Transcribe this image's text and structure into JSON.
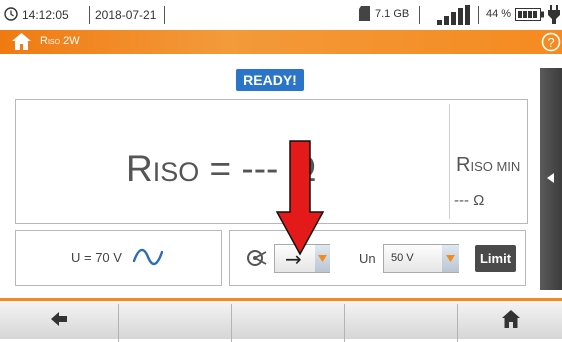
{
  "status_bar": {
    "time": "14:12:05",
    "date": "2018-07-21",
    "storage": "7.1 GB",
    "battery_percent": "44 %",
    "signal_bars": 4
  },
  "header": {
    "title_main": "R",
    "title_sub": "ISO",
    "title_suffix": " 2W"
  },
  "status_badge": "READY!",
  "main_reading": {
    "symbol": "R",
    "subscript": "ISO",
    "equals_value": " = --- Ω"
  },
  "min_reading": {
    "symbol": "R",
    "subscript": "ISO MIN",
    "value": "--- Ω"
  },
  "voltage_panel": {
    "label": "U = 70 V"
  },
  "controls": {
    "mode_value": "→",
    "un_label": "Un",
    "un_value": "50 V",
    "limit_label": "Limit"
  },
  "colors": {
    "accent_orange": "#f28a1f",
    "ready_blue": "#2a74c9",
    "annotation_red": "#e41a1a"
  }
}
